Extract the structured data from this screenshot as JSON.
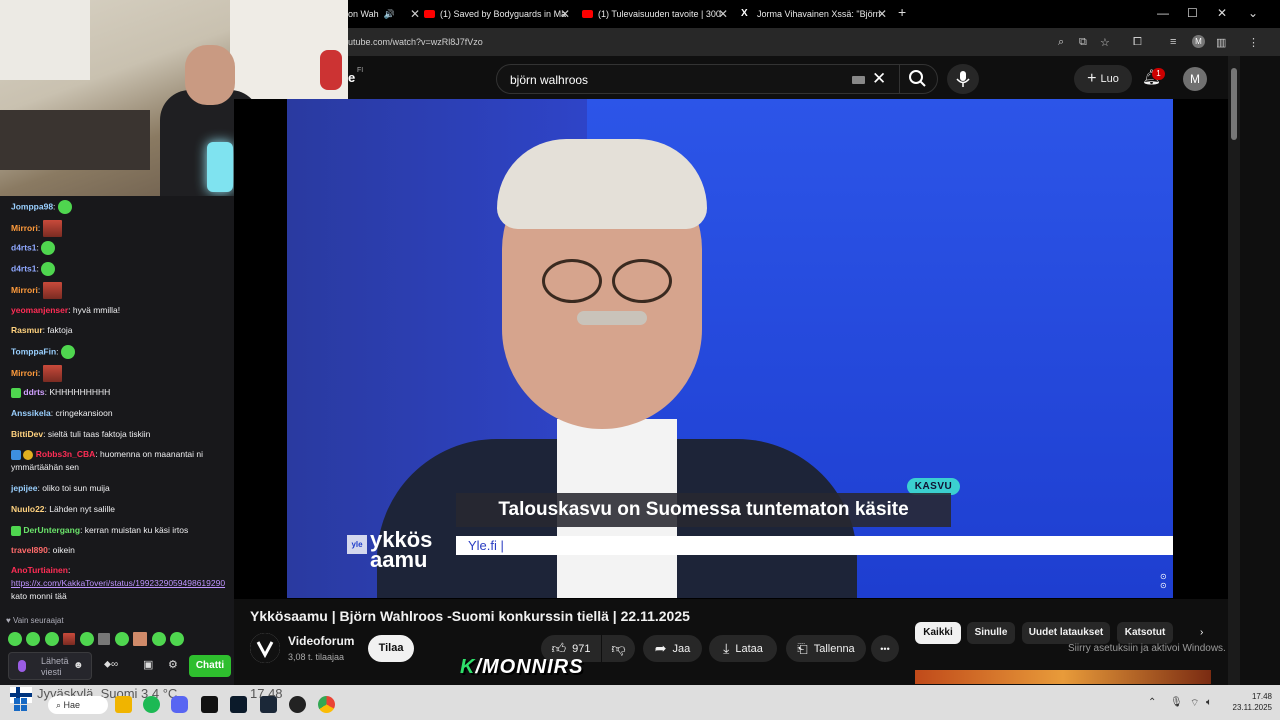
{
  "tabs": [
    {
      "label": "on Wah",
      "active": true
    },
    {
      "label": "(1) Saved by Bodyguards in Ma"
    },
    {
      "label": "(1) Tulevaisuuden tavoite | 300"
    },
    {
      "label": "Jorma Vihavainen Xssä: \"Björn"
    }
  ],
  "address": {
    "url": "utube.com/watch?v=wzRl8J7fVzo"
  },
  "youtube": {
    "logo_fragment": "e",
    "logo_region": "FI",
    "search_value": "björn walhroos",
    "create_label": "Luo",
    "notification_count": "1",
    "avatar_letter": "M"
  },
  "video": {
    "tag": "KASVU",
    "headline": "Talouskasvu on Suomessa tuntematon käsite",
    "ticker": "Yle.fi  |",
    "brand_small": "yle",
    "brand_program": "ykkös aamu"
  },
  "below": {
    "title": "Ykkösaamu | Björn Wahlroos -Suomi konkurssin tiellä | 22.11.2025",
    "channel_name": "Videoforum",
    "channel_subs": "3,08 t. tilaajaa",
    "subscribe_label": "Tilaa",
    "like_count": "971",
    "share_label": "Jaa",
    "download_label": "Lataa",
    "save_label": "Tallenna",
    "more_label": "•••",
    "chips": [
      "Kaikki",
      "Sinulle",
      "Uudet lataukset",
      "Katsotut"
    ],
    "activate_windows": "Siirry asetuksiin ja aktivoi Windows."
  },
  "chat": {
    "lines": [
      {
        "user": "Jomppa98",
        "color": "#9ad0ff",
        "text": "",
        "emote": "green"
      },
      {
        "user": "Mirrori",
        "color": "#ff9b3c",
        "text": "",
        "emote": "img"
      },
      {
        "user": "d4rts1",
        "color": "#8fa8ff",
        "text": "",
        "emote": "green"
      },
      {
        "user": "d4rts1",
        "color": "#8fa8ff",
        "text": "",
        "emote": "green"
      },
      {
        "user": "Mirrori",
        "color": "#ff9b3c",
        "text": "",
        "emote": "img"
      },
      {
        "user": "yeomanjenser",
        "color": "#ff2d55",
        "text": "hyvä mmilla!"
      },
      {
        "user": "Rasmur",
        "color": "#ffd27f",
        "text": "faktoja"
      },
      {
        "user": "TomppaFin",
        "color": "#9ad0ff",
        "text": "",
        "emote": "green"
      },
      {
        "user": "Mirrori",
        "color": "#ff9b3c",
        "text": "",
        "emote": "img"
      },
      {
        "user": "ddrts",
        "color": "#d0a0ff",
        "text": "KHHHHHHHHH"
      },
      {
        "user": "Anssikela",
        "color": "#9ad0ff",
        "text": "cringekansioon"
      },
      {
        "user": "BittiDev",
        "color": "#ffd27f",
        "text": "sieltä tuli taas faktoja tiskiin"
      },
      {
        "user": "Robbs3n_CBA",
        "color": "#ff2d55",
        "text": "huomenna on maanantai ni ymmärtäähän sen"
      },
      {
        "user": "jepijee",
        "color": "#9ad0ff",
        "text": "oliko toi sun muija"
      },
      {
        "user": "Nuulo22",
        "color": "#ffd27f",
        "text": "Lähden nyt salille"
      },
      {
        "user": "DerUntergang",
        "color": "#6be36b",
        "text": "kerran muistan ku käsi irtos"
      },
      {
        "user": "travel890",
        "color": "#ff6b6b",
        "text": "oikein"
      },
      {
        "user": "AnoTurtiainen",
        "color": "#ff2d55",
        "text": "",
        "link": "https://x.com/KakkaToveri/status/1992329059498619290",
        "after": "kato monni tää"
      }
    ],
    "followers_only": "Vain seuraajat",
    "input_placeholder": "Lähetä viesti",
    "send_label": "Chatti"
  },
  "overlay": {
    "brand": "/MONNIRS",
    "brand_k": "K"
  },
  "taskbar": {
    "weather": "Jyväskylä, Suomi   3,4 °C",
    "weather_time": "17.48",
    "search_label": "Hae",
    "time": "17.48",
    "date": "23.11.2025"
  },
  "colors": {
    "yt_bg": "#0f0f0f",
    "chat_bg": "#18181b",
    "chatti_green": "#2ebe2e",
    "studio_blue": "#2450e0"
  }
}
